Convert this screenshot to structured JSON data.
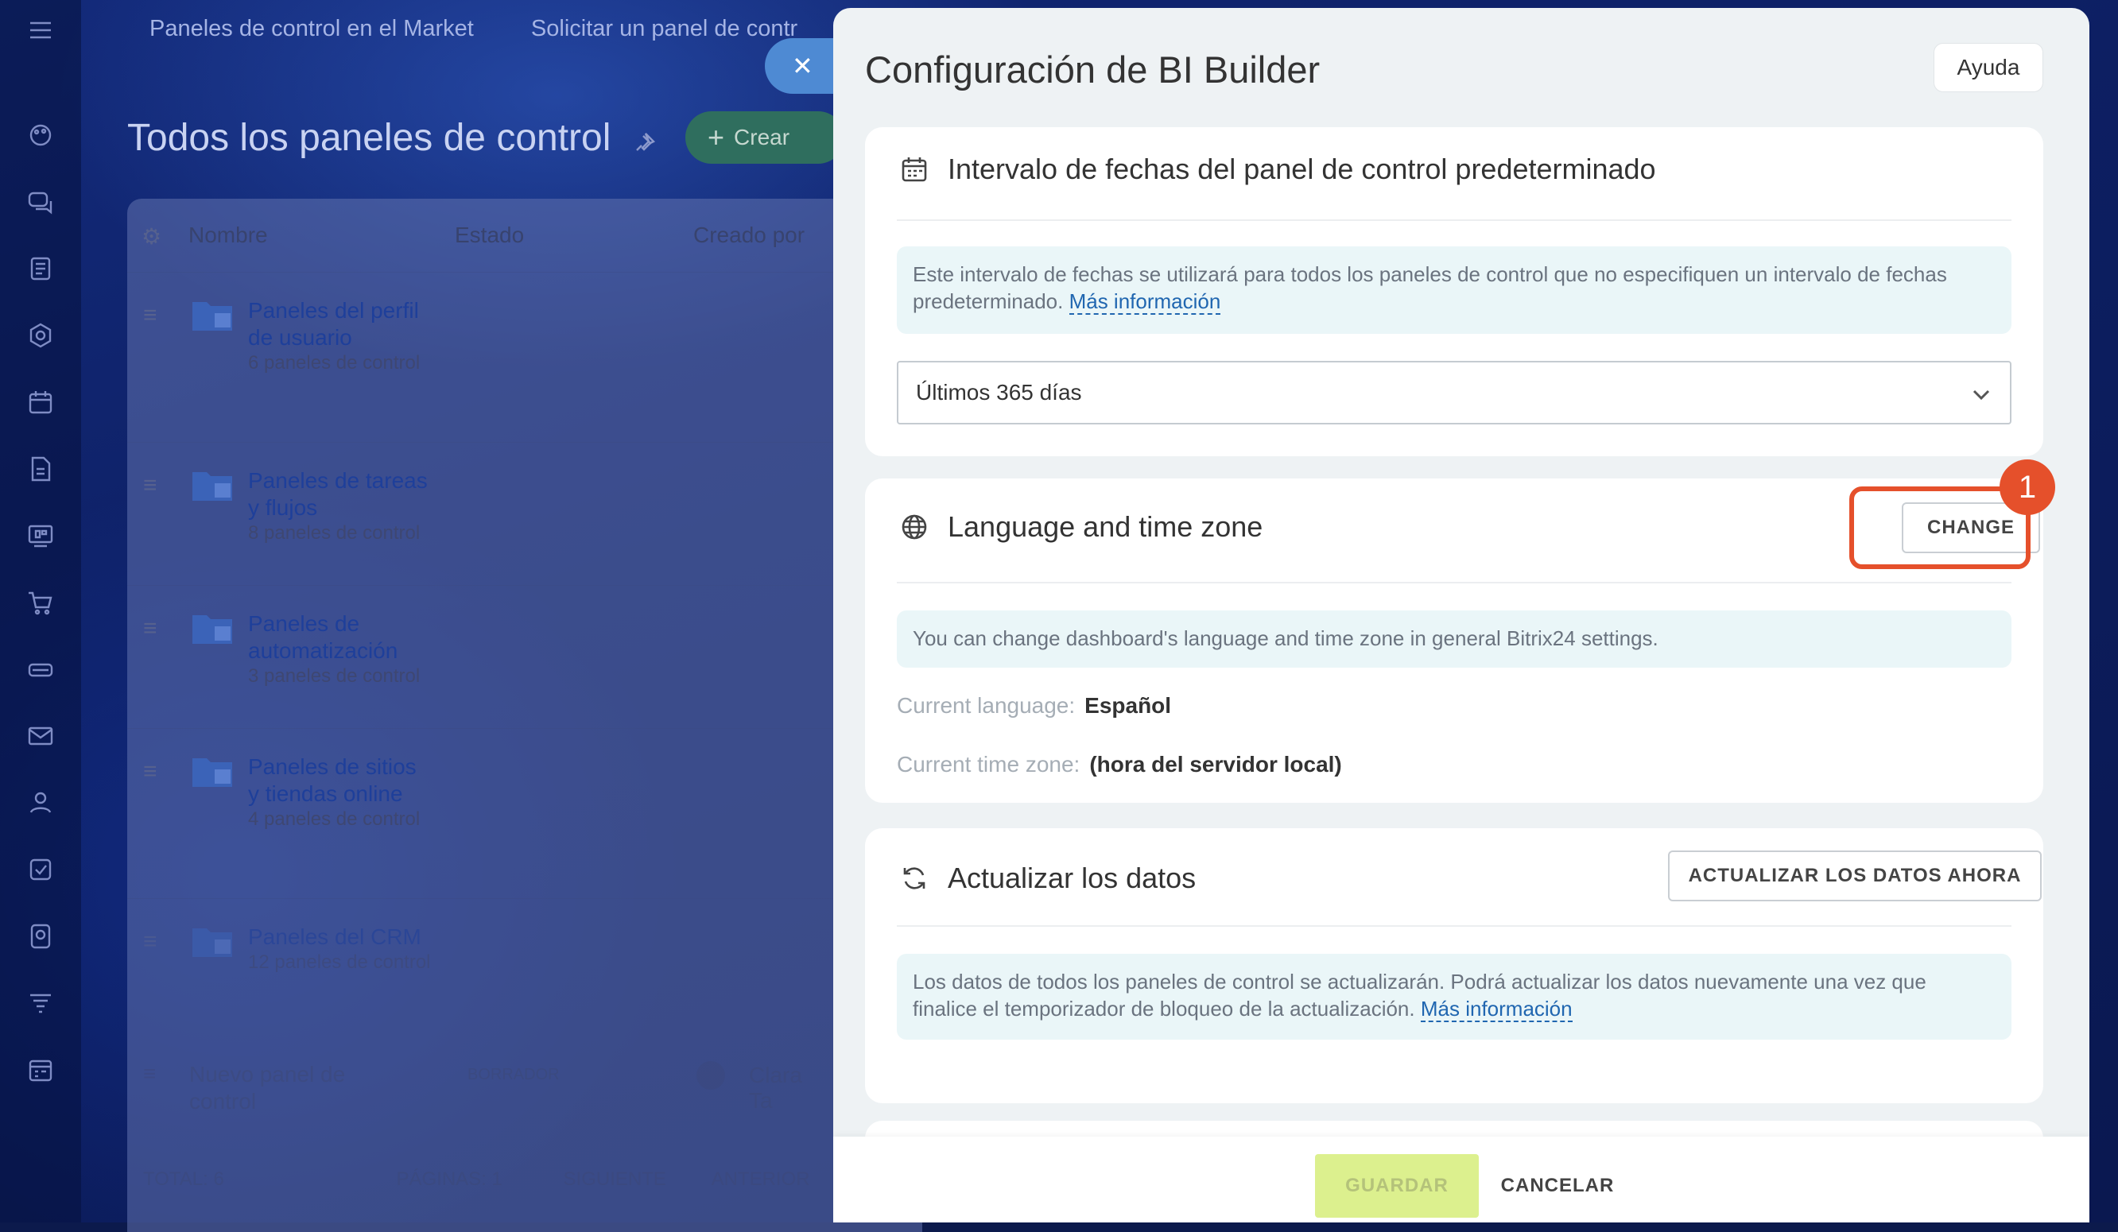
{
  "topnav": {
    "item1": "Paneles de control en el Market",
    "item2": "Solicitar un panel de contr"
  },
  "page": {
    "title": "Todos los paneles de control",
    "create_label": "Crear"
  },
  "table": {
    "headers": [
      "Nombre",
      "Estado",
      "Creado por"
    ],
    "rows": [
      {
        "name": "Paneles del perfil de usuario",
        "count": "6 paneles de control"
      },
      {
        "name": "Paneles de tareas y flujos",
        "count": "8 paneles de control"
      },
      {
        "name": "Paneles de automatización",
        "count": "3 paneles de control"
      },
      {
        "name": "Paneles de sitios y tiendas online",
        "count": "4 paneles de control"
      },
      {
        "name": "Paneles del CRM",
        "count": "12 paneles de control"
      }
    ],
    "draft": {
      "name": "Nuevo panel de control",
      "status": "BORRADOR",
      "author": "Clara Ta"
    },
    "footer": {
      "total": "TOTAL: 6",
      "pages": "PÁGINAS: 1",
      "next": "SIGUIENTE",
      "prev": "ANTERIOR"
    }
  },
  "slider": {
    "title": "Configuración de BI Builder",
    "help_label": "Ayuda",
    "date_section": {
      "title": "Intervalo de fechas del panel de control predeterminado",
      "info": "Este intervalo de fechas se utilizará para todos los paneles de control que no especifiquen un intervalo de fechas predeterminado.",
      "info_link": "Más información",
      "selected": "Últimos 365 días"
    },
    "language_section": {
      "title": "Language and time zone",
      "change_label": "CHANGE",
      "info": "You can change dashboard's language and time zone in general Bitrix24 settings.",
      "language_key": "Current language:",
      "language_value": "Español",
      "timezone_key": "Current time zone:",
      "timezone_value": "(hora del servidor local)"
    },
    "refresh_section": {
      "title": "Actualizar los datos",
      "button_label": "ACTUALIZAR LOS DATOS AHORA",
      "info": "Los datos de todos los paneles de control se actualizarán. Podrá actualizar los datos nuevamente una vez que finalice el temporizador de bloqueo de la actualización.",
      "info_link": "Más información"
    },
    "footer": {
      "save_label": "GUARDAR",
      "cancel_label": "CANCELAR"
    }
  },
  "annotation": {
    "step_number": "1"
  },
  "colors": {
    "accent_red": "#e5502b",
    "save_green": "#dcf08e",
    "link_blue": "#2066b0",
    "close_blue": "#4e8ad3"
  },
  "icons": {
    "menu": "hamburger-icon",
    "rail": [
      "palette-icon",
      "chat-icon",
      "feed-icon",
      "hexagon-icon",
      "calendar-icon",
      "document-icon",
      "chart-board-icon",
      "cart-icon",
      "storage-icon",
      "mail-icon",
      "contacts-icon",
      "tasks-icon",
      "sites-icon",
      "filter-icon",
      "planner-icon"
    ]
  }
}
